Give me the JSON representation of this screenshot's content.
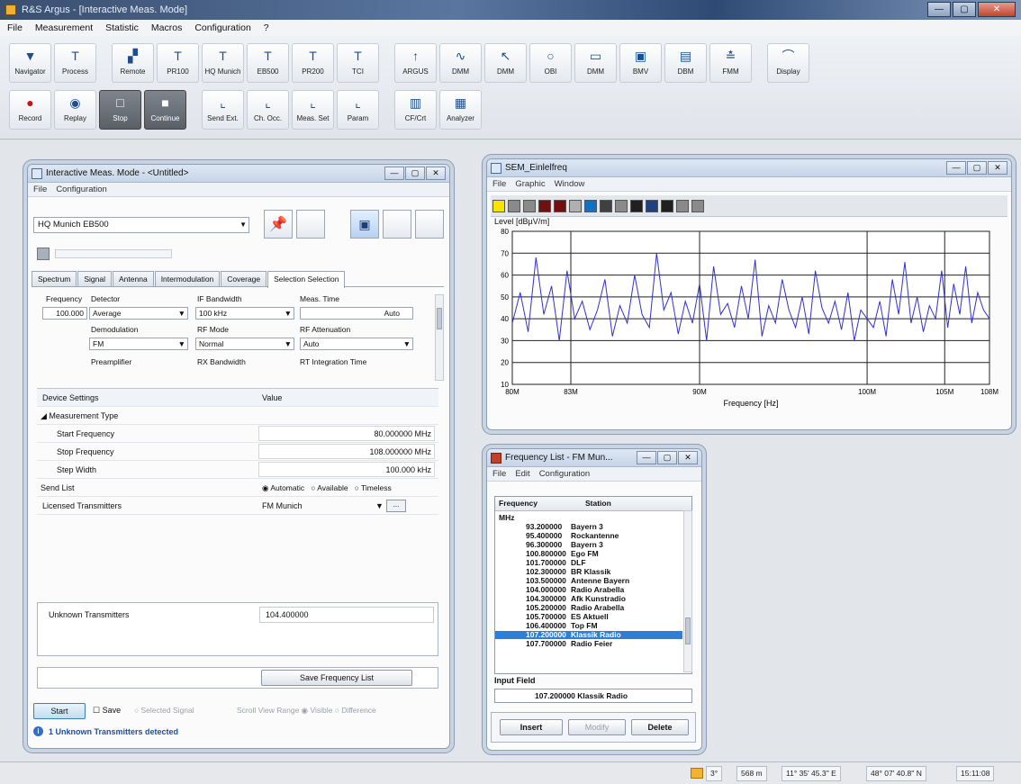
{
  "app": {
    "title": "R&S Argus - [Interactive Meas. Mode]",
    "window_buttons": [
      "—",
      "▢",
      "✕"
    ]
  },
  "menu": [
    "File",
    "Measurement",
    "Statistic",
    "Macros",
    "Configuration",
    "?"
  ],
  "toolbar": {
    "row1": [
      {
        "label": "Navigator",
        "icon": "navigator-icon",
        "glyph": "▼"
      },
      {
        "label": "Process",
        "icon": "process-icon",
        "glyph": "T"
      },
      {
        "label": "Remote",
        "icon": "remote-icon",
        "glyph": "▞"
      },
      {
        "label": "PR100",
        "icon": "antenna-icon",
        "glyph": "T"
      },
      {
        "label": "HQ Munich",
        "icon": "antenna-icon",
        "glyph": "T"
      },
      {
        "label": "EB500",
        "icon": "antenna-icon",
        "glyph": "T"
      },
      {
        "label": "PR200",
        "icon": "antenna-icon",
        "glyph": "T"
      },
      {
        "label": "TCI",
        "icon": "antenna-icon",
        "glyph": "T"
      },
      {
        "label": "ARGUS",
        "icon": "signal-icon",
        "glyph": "↑"
      },
      {
        "label": "DMM",
        "icon": "wave-icon",
        "glyph": "∿"
      },
      {
        "label": "DMM",
        "icon": "cursor-icon",
        "glyph": "↖"
      },
      {
        "label": "OBI",
        "icon": "bulb-icon",
        "glyph": "○"
      },
      {
        "label": "DMM",
        "icon": "monitor-icon",
        "glyph": "▭"
      },
      {
        "label": "BMV",
        "icon": "display-icon",
        "glyph": "▣"
      },
      {
        "label": "DBM",
        "icon": "screen-icon",
        "glyph": "▤"
      },
      {
        "label": "FMM",
        "icon": "tower-icon",
        "glyph": "≛"
      },
      {
        "label": "Display",
        "icon": "chart-icon",
        "glyph": "⌒"
      }
    ],
    "row2": [
      {
        "label": "Record",
        "icon": "record-icon",
        "glyph": "●",
        "dark": false
      },
      {
        "label": "Replay",
        "icon": "replay-icon",
        "glyph": "◉",
        "dark": false
      },
      {
        "label": "Stop",
        "icon": "stop-icon",
        "glyph": "□",
        "dark": true
      },
      {
        "label": "Continue",
        "icon": "continue-icon",
        "glyph": "■",
        "dark": true
      },
      {
        "label": "Send Ext.",
        "icon": "chart-up-icon",
        "glyph": "⌞",
        "dark": false
      },
      {
        "label": "Ch. Occ.",
        "icon": "chart-up-icon",
        "glyph": "⌞",
        "dark": false
      },
      {
        "label": "Meas. Set",
        "icon": "chart-up-icon",
        "glyph": "⌞",
        "dark": false
      },
      {
        "label": "Param",
        "icon": "chart-up-icon",
        "glyph": "⌞",
        "dark": false
      },
      {
        "label": "CF/Crt",
        "icon": "bars-icon",
        "glyph": "▥",
        "dark": false
      },
      {
        "label": "Analyzer",
        "icon": "bars-icon",
        "glyph": "▦",
        "dark": false
      }
    ]
  },
  "imm": {
    "title": "Interactive Meas. Mode - <Untitled>",
    "menu": [
      "File",
      "Configuration"
    ],
    "device": "HQ Munich EB500",
    "tabs": [
      "Spectrum",
      "Signal",
      "Antenna",
      "Intermodulation",
      "Coverage",
      "Selection Selection"
    ],
    "params": {
      "frequency_label": "Frequency",
      "frequency_value": "100.000",
      "detector_label": "Detector",
      "detector_value": "Average",
      "if_bw_label": "IF Bandwidth",
      "if_bw_value": "100 kHz",
      "meas_time_label": "Meas. Time",
      "meas_time_value": "Auto",
      "demod_label": "Demodulation",
      "demod_value": "FM",
      "rf_mode_label": "RF Mode",
      "rf_mode_value": "Normal",
      "rf_atten_label": "RF Attenuation",
      "rf_atten_value": "Auto",
      "preamp_label": "Preamplifier",
      "rx_bw_label": "RX Bandwidth",
      "int_time_label": "RT Integration Time"
    },
    "grid": {
      "col_settings": "Device Settings",
      "col_value": "Value",
      "cat_meas_type": "Measurement Type",
      "start_freq_label": "Start Frequency",
      "start_freq_value": "80.000000 MHz",
      "stop_freq_label": "Stop Frequency",
      "stop_freq_value": "108.000000 MHz",
      "step_label": "Step Width",
      "step_value": "100.000 kHz",
      "send_list_label": "Send List",
      "send_opts": [
        "Automatic",
        "Available",
        "Timeless"
      ],
      "licensed_label": "Licensed Transmitters",
      "licensed_value": "FM Munich"
    },
    "unknown_label": "Unknown Transmitters",
    "unknown_value": "104.400000",
    "save_freq_btn": "Save Frequency List",
    "start_btn": "Start",
    "save_label": "Save",
    "selected_signal_label": "Selected Signal",
    "scroll_view_label": "Scroll View Range",
    "visible_label": "Visible",
    "difference_label": "Difference",
    "status_msg": "1 Unknown Transmitters detected"
  },
  "spec": {
    "title": "SEM_Einlelfreq",
    "menu": [
      "File",
      "Graphic",
      "Window"
    ],
    "swatch_colors": [
      "#f7e400",
      "#8a8a8a",
      "#8a8a8a",
      "#701010",
      "#701010",
      "#b0b0b0",
      "#1570c0",
      "#404040",
      "#8a8a8a",
      "#202020",
      "#204080",
      "#202020",
      "#8a8a8a",
      "#8a8a8a"
    ],
    "ylabel_text": "Level [dBµV/m]",
    "xlabel_text": "Frequency [Hz]"
  },
  "chart_data": {
    "type": "line",
    "ylabel": "Level [dBµV/m]",
    "xlabel": "Frequency [Hz]",
    "ylim": [
      10,
      80
    ],
    "yticks": [
      10,
      20,
      30,
      40,
      50,
      60,
      70,
      80
    ],
    "xlim": [
      80,
      108
    ],
    "xscale": "log",
    "xticks_labels": [
      {
        "v": 80,
        "t": "80M"
      },
      {
        "v": 83,
        "t": "83M"
      },
      {
        "v": 90,
        "t": "90M"
      },
      {
        "v": 100,
        "t": "100M"
      },
      {
        "v": 105,
        "t": "105M"
      },
      {
        "v": 108,
        "t": "108M"
      }
    ],
    "grid": true,
    "series": [
      {
        "color": "#3030d0",
        "x": [
          80,
          80.4,
          80.8,
          81.2,
          81.6,
          82.0,
          82.4,
          82.8,
          83.2,
          83.6,
          84.0,
          84.4,
          84.8,
          85.2,
          85.6,
          86.0,
          86.4,
          86.8,
          87.2,
          87.6,
          88.0,
          88.4,
          88.8,
          89.2,
          89.6,
          90.0,
          90.4,
          90.8,
          91.2,
          91.6,
          92.0,
          92.4,
          92.8,
          93.2,
          93.6,
          94.0,
          94.4,
          94.8,
          95.2,
          95.6,
          96.0,
          96.4,
          96.8,
          97.2,
          97.6,
          98.0,
          98.4,
          98.8,
          99.2,
          99.6,
          100.0,
          100.4,
          100.8,
          101.2,
          101.6,
          102.0,
          102.4,
          102.8,
          103.2,
          103.6,
          104.0,
          104.4,
          104.8,
          105.2,
          105.6,
          106.0,
          106.4,
          106.8,
          107.2,
          107.6,
          108.0
        ],
        "y": [
          38,
          52,
          34,
          68,
          42,
          55,
          30,
          62,
          40,
          48,
          35,
          44,
          58,
          32,
          46,
          38,
          60,
          42,
          36,
          70,
          44,
          52,
          33,
          48,
          38,
          56,
          30,
          64,
          42,
          47,
          36,
          55,
          40,
          67,
          32,
          46,
          38,
          58,
          44,
          36,
          50,
          33,
          62,
          45,
          38,
          48,
          35,
          52,
          30,
          44,
          40,
          36,
          48,
          32,
          58,
          42,
          66,
          38,
          50,
          34,
          46,
          40,
          62,
          36,
          56,
          42,
          64,
          38,
          52,
          44,
          40
        ]
      }
    ]
  },
  "flist": {
    "title": "Frequency List - FM Mun...",
    "menu": [
      "File",
      "Edit",
      "Configuration"
    ],
    "col_freq": "Frequency",
    "col_station": "Station",
    "group": "MHz",
    "items": [
      {
        "f": "93.200000",
        "n": "Bayern 3"
      },
      {
        "f": "95.400000",
        "n": "Rockantenne"
      },
      {
        "f": "96.300000",
        "n": "Bayern 3"
      },
      {
        "f": "100.800000",
        "n": "Ego FM"
      },
      {
        "f": "101.700000",
        "n": "DLF"
      },
      {
        "f": "102.300000",
        "n": "BR Klassik"
      },
      {
        "f": "103.500000",
        "n": "Antenne Bayern"
      },
      {
        "f": "104.000000",
        "n": "Radio Arabella"
      },
      {
        "f": "104.300000",
        "n": "Afk Kunstradio"
      },
      {
        "f": "105.200000",
        "n": "Radio Arabella"
      },
      {
        "f": "105.700000",
        "n": "ES Aktuell"
      },
      {
        "f": "106.400000",
        "n": "Top FM"
      },
      {
        "f": "107.200000",
        "n": "Klassik Radio"
      },
      {
        "f": "107.700000",
        "n": "Radio Feier"
      }
    ],
    "selected_index": 12,
    "input_label": "Input Field",
    "input_value": "107.200000 Klassik Radio",
    "btn_insert": "Insert",
    "btn_modify": "Modify",
    "btn_delete": "Delete"
  },
  "statusbar": {
    "seg1": "3°",
    "seg2": "568 m",
    "seg3": "11° 35' 45.3'' E",
    "seg4": "48° 07' 40.8'' N",
    "seg5": "15:11:08"
  }
}
